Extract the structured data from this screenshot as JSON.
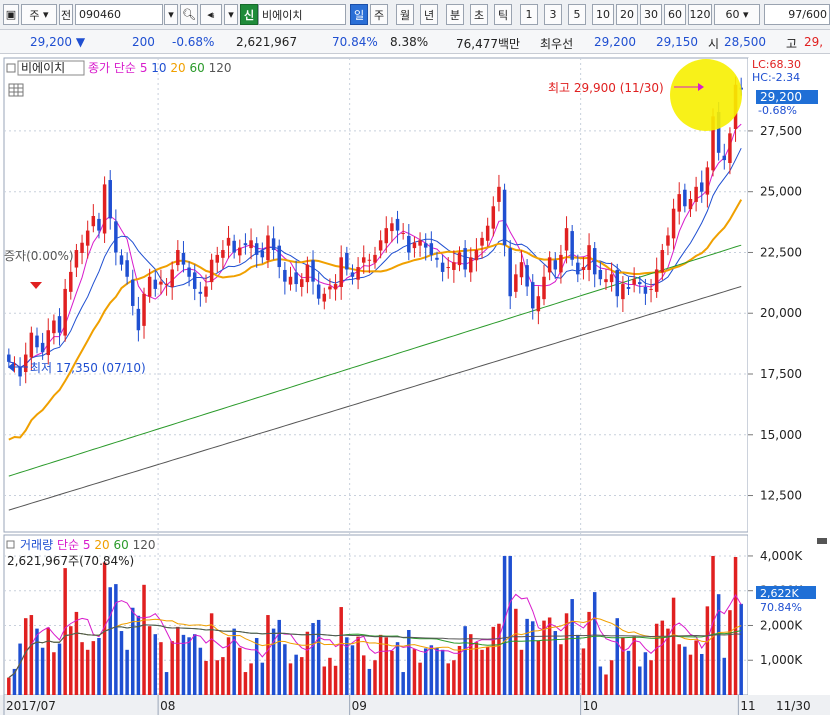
{
  "toolbar": {
    "market": "주",
    "prefix": "전",
    "code": "090460",
    "badge": "신",
    "stock_name": "비에이치",
    "periods": [
      "일",
      "주",
      "월",
      "년",
      "분",
      "초",
      "틱"
    ],
    "selected_period": "일",
    "intervals": [
      "1",
      "3",
      "5",
      "10",
      "20",
      "30",
      "60",
      "120"
    ],
    "interval_value": "60",
    "count": "97",
    "count_total": "/600"
  },
  "quote": {
    "price": "29,200",
    "change": "200",
    "change_pct": "-0.68%",
    "volume": "2,621,967",
    "vol_ratio": "70.84%",
    "turnover": "8.38%",
    "amount": "76,477백만",
    "best_label": "최우선",
    "ask": "29,200",
    "bid": "29,150",
    "open_label": "시",
    "open": "28,500",
    "high_label": "고",
    "high_partial": "29,"
  },
  "colors": {
    "up": "#e02020",
    "down": "#1f4fd1",
    "ma5": "#d81ccc",
    "ma10": "#1f4fd1",
    "ma20": "#f0a000",
    "ma60": "#2a9a2a",
    "ma120": "#555555",
    "grid": "#c8d0dc",
    "highlight": "#f7f000"
  },
  "chart_data": [
    {
      "type": "candlestick",
      "title": "비에이치",
      "legend_prefix": "종가 단순",
      "legend": [
        "5",
        "10",
        "20",
        "60",
        "120"
      ],
      "ylim": [
        11000,
        30500
      ],
      "y_ticks": [
        "12,500",
        "15,000",
        "17,500",
        "20,000",
        "22,500",
        "25,000",
        "27,500"
      ],
      "x_labels": [
        "2017/07",
        "08",
        "09",
        "10",
        "11"
      ],
      "x_last_label": "11/30",
      "current_price_label": "29,200",
      "current_change_label": "-0.68%",
      "lc_label": "LC:68.30",
      "hc_label": "HC:-2.34",
      "high_annotation": "최고 29,900 (11/30)",
      "low_annotation": "최저 17,350 (07/10)",
      "left_label": "증자(0.00%)",
      "close": [
        18000,
        17900,
        17400,
        18300,
        19200,
        18600,
        18400,
        19300,
        19700,
        19200,
        21000,
        21700,
        22600,
        22900,
        23400,
        24000,
        23400,
        25300,
        23900,
        22500,
        22000,
        21500,
        20300,
        19300,
        20800,
        21500,
        21000,
        21300,
        21200,
        21800,
        22600,
        22000,
        21500,
        21000,
        20800,
        21100,
        22200,
        22400,
        22600,
        23100,
        22500,
        22700,
        22800,
        23000,
        22400,
        22300,
        23200,
        22600,
        21900,
        21300,
        21500,
        21200,
        21400,
        22000,
        21300,
        20600,
        20800,
        21100,
        21200,
        22300,
        21800,
        21500,
        21900,
        22300,
        22200,
        22400,
        23000,
        23500,
        23700,
        23400,
        23300,
        22500,
        22900,
        23000,
        22700,
        22400,
        22200,
        21700,
        21900,
        22100,
        22500,
        21800,
        22300,
        22600,
        23100,
        23600,
        24400,
        25200,
        22800,
        20700,
        21600,
        22100,
        21100,
        20200,
        20700,
        21500,
        22300,
        21800,
        22400,
        23500,
        22200,
        21600,
        21900,
        22800,
        21600,
        21400,
        21400,
        21600,
        20700,
        21200,
        21000,
        21400,
        21200,
        20800,
        21000,
        21800,
        22600,
        23200,
        24300,
        24900,
        24400,
        24700,
        25200,
        25000,
        26000,
        28100,
        26600,
        26300,
        27400,
        29400,
        29200
      ],
      "ma_series": [
        {
          "name": "5",
          "values_note": ""
        },
        {
          "name": "10",
          "values_note": ""
        },
        {
          "name": "20",
          "values_note": ""
        },
        {
          "name": "60",
          "values_note": ""
        },
        {
          "name": "120",
          "values_note": ""
        }
      ]
    },
    {
      "type": "bar",
      "title": "거래량",
      "legend_prefix": "단순",
      "legend": [
        "5",
        "20",
        "60",
        "120"
      ],
      "info": "2,621,967주(70.84%)",
      "ylim": [
        0,
        4200
      ],
      "y_ticks": [
        "1,000K",
        "2,000K",
        "3,000K",
        "4,000K"
      ],
      "current_label": "2,622K",
      "current_pct": "70.84%",
      "unit": "K"
    }
  ]
}
